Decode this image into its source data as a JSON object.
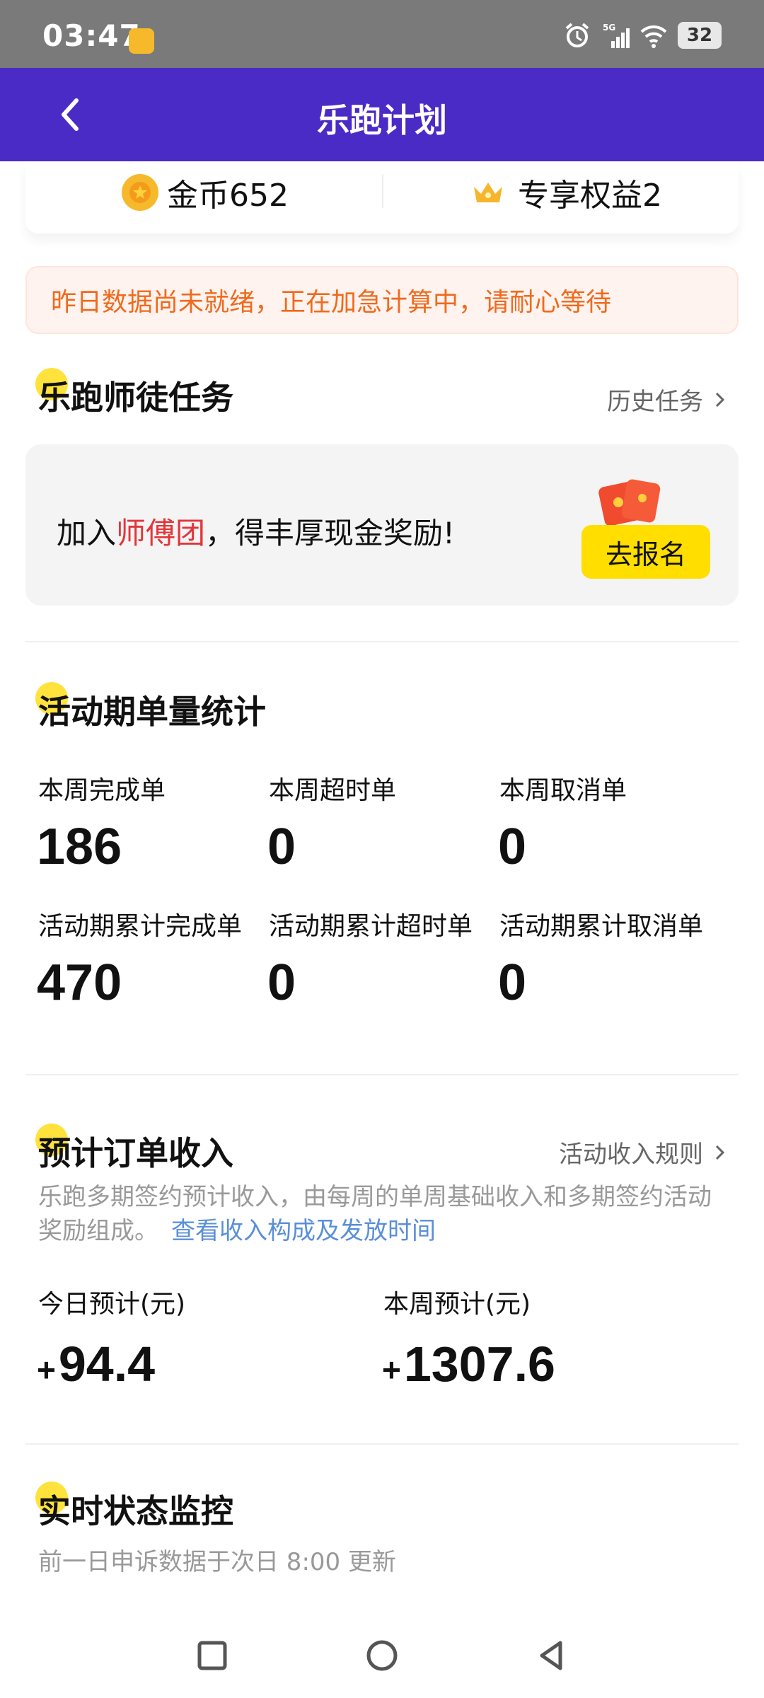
{
  "status_bar": {
    "time": "03:47",
    "network": "5G",
    "battery": "32"
  },
  "app_bar": {
    "title": "乐跑计划",
    "back_icon": "chevron-left-icon"
  },
  "summary": {
    "coins": "金币652",
    "benefits": "专享权益2"
  },
  "notice": "昨日数据尚未就绪，正在加急计算中，请耐心等待",
  "mentor_section": {
    "title_first": "乐",
    "title_rest": "跑师徒任务",
    "history_link": "历史任务",
    "invite_prefix": "加入",
    "invite_highlight": "师傅团",
    "invite_suffix": "，得丰厚现金奖励!",
    "join_button": "去报名",
    "accent": "#ffde00"
  },
  "order_stats": {
    "title_first": "活",
    "title_rest": "动期单量统计",
    "items": [
      {
        "label": "本周完成单",
        "value": "186"
      },
      {
        "label": "本周超时单",
        "value": "0"
      },
      {
        "label": "本周取消单",
        "value": "0"
      },
      {
        "label": "活动期累计完成单",
        "value": "470"
      },
      {
        "label": "活动期累计超时单",
        "value": "0"
      },
      {
        "label": "活动期累计取消单",
        "value": "0"
      }
    ]
  },
  "income": {
    "title_first": "预",
    "title_rest": "计订单收入",
    "rules_link": "活动收入规则",
    "description": "乐跑多期签约预计收入，由每周的单周基础收入和多期签约活动奖励组成。",
    "description_link": "查看收入构成及发放时间",
    "today_label": "今日预计(元)",
    "today_value": "94.4",
    "week_label": "本周预计(元)",
    "week_value": "1307.6",
    "sign": "+"
  },
  "monitor": {
    "title_first": "实",
    "title_rest": "时状态监控",
    "subtitle": "前一日申诉数据于次日 8:00 更新"
  },
  "colors": {
    "app_bar": "#4a2bc6",
    "highlight": "#ffe23c",
    "notice_text": "#f06a1d",
    "link": "#5a8fd8",
    "red": "#e3363b"
  }
}
